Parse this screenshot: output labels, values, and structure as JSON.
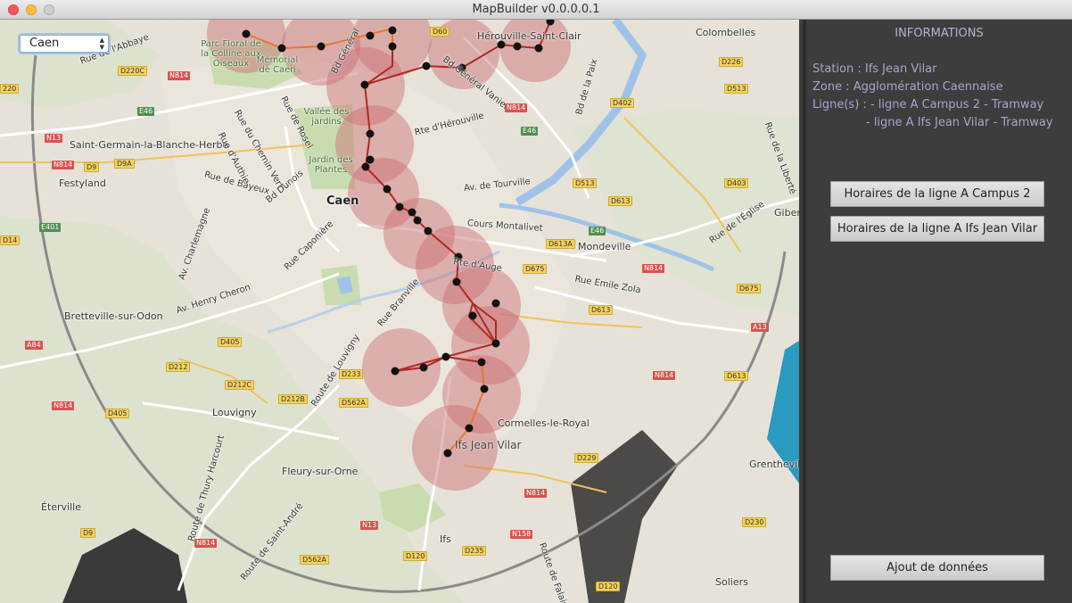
{
  "window": {
    "title": "MapBuilder v0.0.0.0.1",
    "controls": [
      "close",
      "minimize",
      "zoom"
    ]
  },
  "city_selector": {
    "value": "Caen",
    "icon": "up-down-arrows-icon"
  },
  "map": {
    "places": {
      "caen": "Caen",
      "mondeville": "Mondeville",
      "herouville": "Hérouville-Saint-Clair",
      "colombelles": "Colombelles",
      "bretteville": "Bretteville-sur-Odon",
      "louvigny": "Louvigny",
      "fleury": "Fleury-sur-Orne",
      "eterville": "Éterville",
      "ifs": "Ifs",
      "cormelles": "Cormelles-le-Royal",
      "festyland": "Festyland",
      "saint_germain": "Saint-Germain-la-Blanche-Herbe",
      "solliers": "Soliers",
      "grentheville": "Grentheville",
      "giberville": "Giber"
    },
    "parks": {
      "parc_floral": "Parc Floral de la Colline aux Oiseaux",
      "memorial": "Mémorial de Caen",
      "vallee_jardins": "Vallée des jardins",
      "jardin_plantes": "Jardin des Plantes"
    },
    "streets": {
      "tourville": "Av. de Tourville",
      "montalivet": "Cours Montalivet",
      "auge": "Rte d'Auge",
      "emile_zola": "Rue Emile Zola",
      "branville": "Rue Branville",
      "route_louvigny": "Route de Louvigny",
      "henry_cheron": "Av. Henry Cheron",
      "caponiere": "Rue Caponière",
      "bayeux": "Rue de Bayeux",
      "chemin_vert": "Rue du Chemin Vert",
      "authie": "Rue d'Authie",
      "dunois": "Bd Dunois",
      "rosel": "Rue de Rosel",
      "charlemagne": "Av. Charlemagne",
      "herouville_rte": "Rte d'Hérouville",
      "general_vanier": "Bd Général Vanier",
      "general": "Bd Général",
      "bd_paix": "Bd de la Paix",
      "thury": "Route de Thury Harcourt",
      "saint_andre": "Route de Saint-André",
      "falaise": "Route de Falaise",
      "liberte": "Rue de la Liberté",
      "eglise": "Rue de l'Église",
      "abbaye": "Rue de l'Abbaye"
    },
    "road_badges": {
      "red": [
        "N814",
        "N13",
        "N814",
        "N814",
        "N814",
        "N814",
        "N814",
        "N814",
        "N158",
        "N814",
        "A84",
        "A13",
        "N13"
      ],
      "yellow": [
        "D220C",
        "220",
        "D9A",
        "D9",
        "D14",
        "D405",
        "D212",
        "D212C",
        "D212B",
        "D405",
        "D233",
        "D562A",
        "D229",
        "D562A",
        "D120",
        "D235",
        "D120",
        "D675",
        "D613",
        "D613",
        "D613A",
        "D513",
        "D402",
        "D226",
        "D513",
        "D403",
        "D675",
        "D613",
        "D230",
        "D60",
        "D9"
      ],
      "green": [
        "E46",
        "E46",
        "E401",
        "E46"
      ]
    },
    "selected_station_label": "Ifs Jean Vilar"
  },
  "tramway": {
    "line_colors": {
      "campus2": "#b02a20",
      "ifs_jean_vilar": "#e8772e"
    },
    "catchment_color": "#c96b72",
    "station_color": "#111111"
  },
  "panel": {
    "title": "INFORMATIONS",
    "station": "Station : Ifs Jean Vilar",
    "zone": "Zone : Agglomération Caennaise",
    "lines_label": "Ligne(s) : - ligne A Campus 2 - Tramway",
    "lines_extra": "- ligne A Ifs Jean Vilar - Tramway",
    "buttons": {
      "schedule_campus2": "Horaires de la ligne A Campus 2",
      "schedule_ifs": "Horaires de la ligne A Ifs Jean Vilar",
      "add_data": "Ajout de données"
    }
  }
}
